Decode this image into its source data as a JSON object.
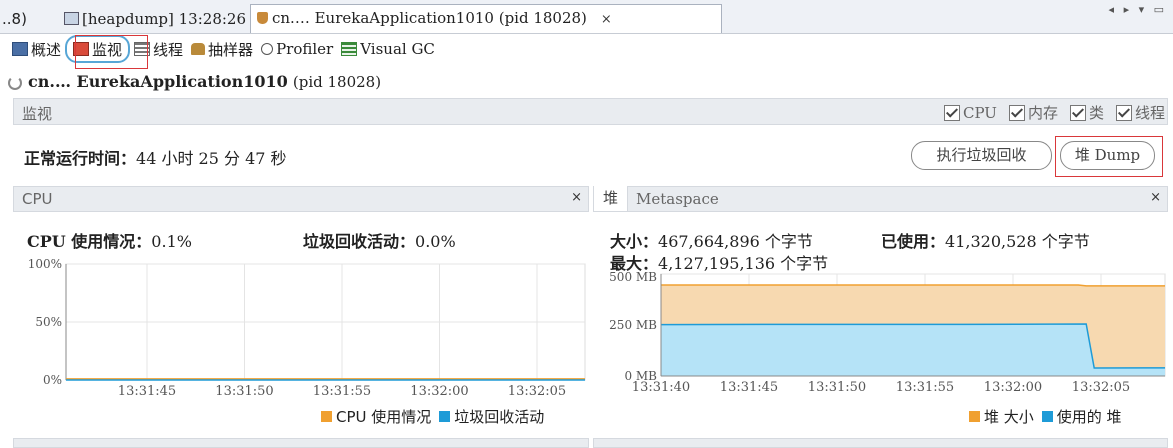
{
  "tabs": {
    "prev_label": "..8)",
    "heap_label": "[heapdump] 13:28:26",
    "active_label": "cn.… EurekaApplication1010 (pid 18028)",
    "close_glyph": "×"
  },
  "toolbar": {
    "items": [
      "概述",
      "监视",
      "线程",
      "抽样器",
      "Profiler",
      "Visual GC"
    ]
  },
  "app": {
    "name": "cn.… EurekaApplication1010",
    "pid": "(pid 18028)"
  },
  "monitor": {
    "section_label": "监视",
    "checks": [
      "CPU",
      "内存",
      "类",
      "线程"
    ],
    "uptime_label": "正常运行时间：",
    "uptime_value": "44 小时 25 分 47 秒",
    "gc_button": "执行垃圾回收",
    "heapdump_button": "堆 Dump"
  },
  "cpu_panel": {
    "title": "CPU",
    "usage_label": "CPU 使用情况：",
    "usage_value": "0.1%",
    "gc_label": "垃圾回收活动：",
    "gc_value": "0.0%",
    "legend": [
      "CPU 使用情况",
      "垃圾回收活动"
    ]
  },
  "heap_panel": {
    "tab_heap": "堆",
    "tab_meta": "Metaspace",
    "size_label": "大小：",
    "size_value": "467,664,896 个字节",
    "used_label": "已使用：",
    "used_value": "41,320,528 个字节",
    "max_label": "最大：",
    "max_value": "4,127,195,136 个字节",
    "legend": [
      "堆 大小",
      "使用的 堆"
    ]
  },
  "colors": {
    "orange": "#f0a030",
    "blue": "#1e9bd7",
    "heap_fill": "#f7d9b0",
    "used_fill": "#b5e3f7",
    "red_highlight": "#d9373a"
  },
  "chart_data": [
    {
      "type": "line",
      "title": "CPU",
      "x": [
        "13:31:45",
        "13:31:50",
        "13:31:55",
        "13:32:00",
        "13:32:05"
      ],
      "ytick_labels": [
        "0%",
        "50%",
        "100%"
      ],
      "ylim": [
        0,
        100
      ],
      "series": [
        {
          "name": "CPU 使用情况",
          "values": [
            0.1,
            0.1,
            0.1,
            0.1,
            0.1
          ]
        },
        {
          "name": "垃圾回收活动",
          "values": [
            0,
            0,
            0,
            0,
            0
          ]
        }
      ],
      "grid": true,
      "legend": "bottom-right"
    },
    {
      "type": "area",
      "title": "堆",
      "x": [
        "13:31:40",
        "13:31:45",
        "13:31:50",
        "13:31:55",
        "13:32:00",
        "13:32:05"
      ],
      "ytick_labels": [
        "0 MB",
        "250 MB",
        "500 MB"
      ],
      "ylim": [
        0,
        500
      ],
      "series": [
        {
          "name": "堆 大小",
          "values": [
            446,
            446,
            446,
            446,
            446,
            446
          ],
          "drop_after": "13:32:00",
          "final_value": 442
        },
        {
          "name": "使用的 堆",
          "values": [
            252,
            253,
            253,
            253,
            255,
            39
          ],
          "final_value": 40
        }
      ],
      "grid": true,
      "legend": "bottom-right"
    }
  ]
}
